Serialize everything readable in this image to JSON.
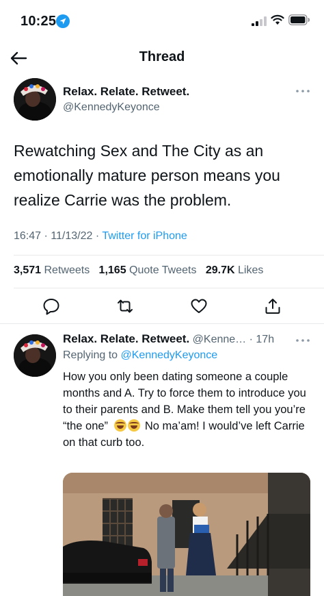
{
  "status_bar": {
    "time": "10:25",
    "icons": [
      "location-arrow-icon",
      "signal-icon",
      "wifi-icon",
      "battery-icon"
    ]
  },
  "header": {
    "title": "Thread",
    "back_icon": "back-arrow-icon"
  },
  "main_tweet": {
    "author_name": "Relax. Relate. Retweet.",
    "handle": "@KennedyKeyonce",
    "text": "Rewatching Sex and The City as an emotionally mature person means you realize Carrie was the problem.",
    "time": "16:47",
    "date": "11/13/22",
    "source": "Twitter for iPhone",
    "stats": {
      "retweets_count": "3,571",
      "retweets_label": "Retweets",
      "quotes_count": "1,165",
      "quotes_label": "Quote Tweets",
      "likes_count": "29.7K",
      "likes_label": "Likes"
    },
    "actions": [
      "reply-icon",
      "retweet-icon",
      "like-icon",
      "share-icon"
    ]
  },
  "reply": {
    "author_name": "Relax. Relate. Retweet.",
    "handle": "@Kenne…",
    "age": "17h",
    "replying_prefix": "Replying to",
    "replying_to": "@KennedyKeyonce",
    "text_before_emoji": "How you only been dating someone a couple months and A. Try to force them to introduce you to their parents and B. Make them tell you you’re “the one”",
    "emoji": "😂😂",
    "text_after_emoji": "No ma’am! I would’ve left Carrie on that curb too."
  },
  "colors": {
    "accent": "#1d9bf0",
    "secondary_text": "#536471",
    "divider": "#e7e9ea"
  }
}
